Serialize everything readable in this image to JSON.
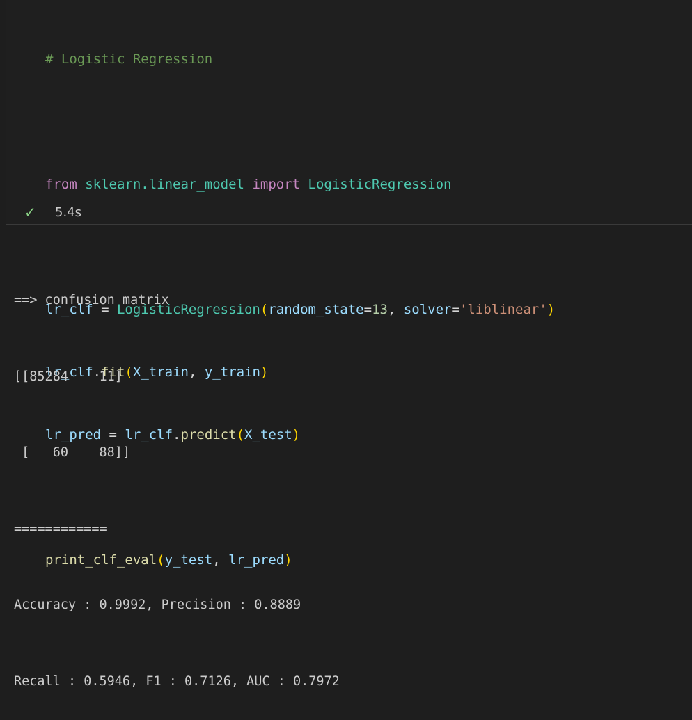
{
  "code_cell": {
    "comment": "# Logistic Regression",
    "import_from": "from",
    "import_module": "sklearn.linear_model",
    "import_kw": "import",
    "import_name": "LogisticRegression",
    "l3": {
      "var": "lr_clf",
      "eq": " = ",
      "cls": "LogisticRegression",
      "open": "(",
      "param1": "random_state",
      "eq1": "=",
      "val1": "13",
      "sep": ", ",
      "param2": "solver",
      "eq2": "=",
      "val2": "'liblinear'",
      "close": ")"
    },
    "l4": {
      "obj": "lr_clf",
      "dot": ".",
      "fn": "fit",
      "open": "(",
      "arg1": "X_train",
      "sep": ", ",
      "arg2": "y_train",
      "close": ")"
    },
    "l5": {
      "var": "lr_pred",
      "eq": " = ",
      "obj": "lr_clf",
      "dot": ".",
      "fn": "predict",
      "open": "(",
      "arg": "X_test",
      "close": ")"
    },
    "l6": {
      "fn": "print_clf_eval",
      "open": "(",
      "arg1": "y_test",
      "sep": ", ",
      "arg2": "lr_pred",
      "close": ")"
    }
  },
  "status": {
    "icon": "check-icon",
    "check_glyph": "✓",
    "duration": "5.4s"
  },
  "output": {
    "lines": [
      "==> confusion matrix",
      "[[85284    11]",
      " [   60    88]]",
      "============",
      "Accuracy : 0.9992, Precision : 0.8889",
      "Recall : 0.5946, F1 : 0.7126, AUC : 0.7972"
    ]
  },
  "colors": {
    "background": "#1e1e1e",
    "comment": "#6a9955",
    "keyword": "#c586c0",
    "class": "#4ec9b0",
    "variable": "#9cdcfe",
    "function": "#dcdcaa",
    "number": "#b5cea8",
    "string": "#ce9178",
    "bracket": "#ffd700",
    "success": "#89d185"
  }
}
